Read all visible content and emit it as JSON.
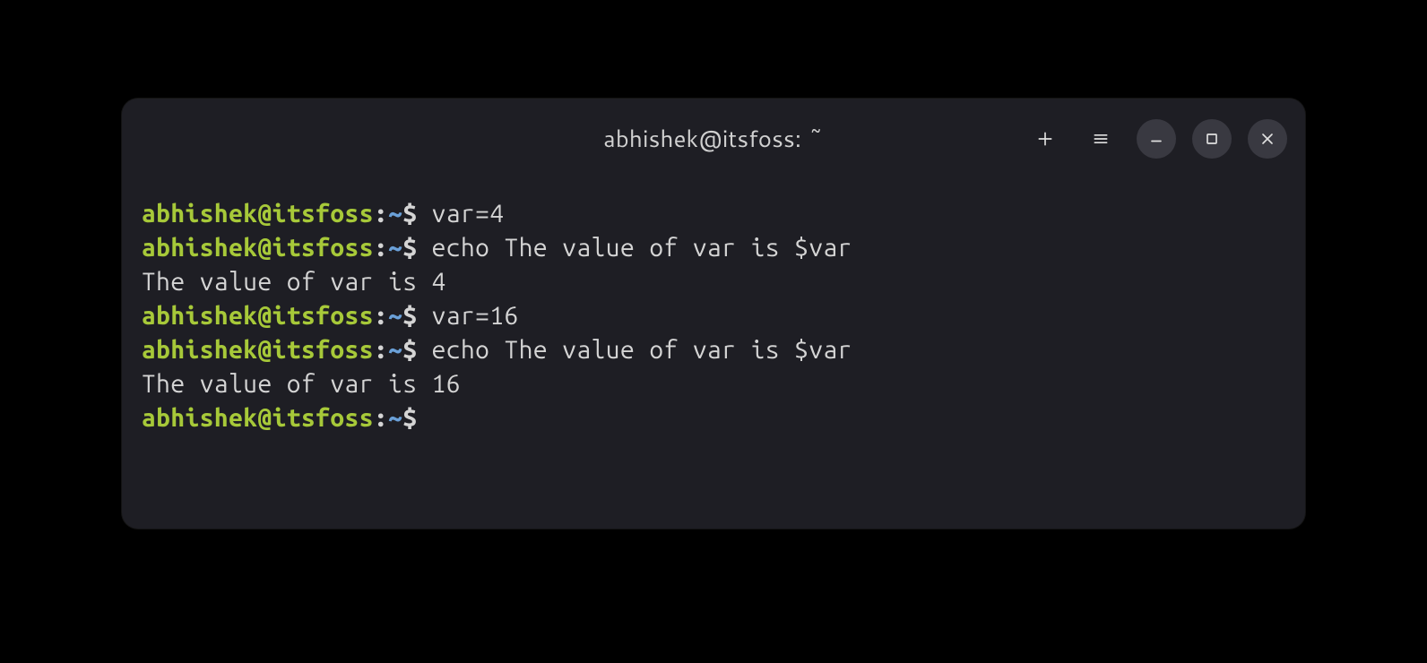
{
  "window": {
    "title": "abhishek@itsfoss: ~"
  },
  "prompt": {
    "userhost": "abhishek@itsfoss",
    "colon": ":",
    "path": "~",
    "dollar": "$"
  },
  "lines": [
    {
      "type": "prompt",
      "command": "var=4"
    },
    {
      "type": "prompt",
      "command": "echo The value of var is $var"
    },
    {
      "type": "output",
      "text": "The value of var is 4"
    },
    {
      "type": "prompt",
      "command": "var=16"
    },
    {
      "type": "prompt",
      "command": "echo The value of var is $var"
    },
    {
      "type": "output",
      "text": "The value of var is 16"
    },
    {
      "type": "prompt",
      "command": ""
    }
  ],
  "icons": {
    "new_tab": "plus-icon",
    "menu": "hamburger-icon",
    "minimize": "minimize-icon",
    "maximize": "maximize-icon",
    "close": "close-icon"
  }
}
